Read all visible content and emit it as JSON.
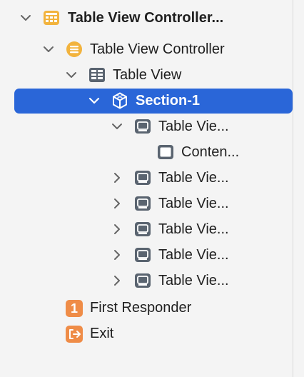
{
  "outline": {
    "items": [
      {
        "label": "Table View Controller...",
        "icon": "storyboard-scene-icon",
        "expanded": true
      },
      {
        "label": "Table View Controller",
        "icon": "table-view-controller-icon",
        "expanded": true
      },
      {
        "label": "Table View",
        "icon": "table-view-icon",
        "expanded": true
      },
      {
        "label": "Section-1",
        "icon": "section-icon",
        "expanded": true,
        "selected": true
      },
      {
        "label": "Table Vie...",
        "icon": "table-view-cell-icon",
        "expanded": true
      },
      {
        "label": "Conten...",
        "icon": "content-view-icon"
      },
      {
        "label": "Table Vie...",
        "icon": "table-view-cell-icon",
        "expanded": false
      },
      {
        "label": "Table Vie...",
        "icon": "table-view-cell-icon",
        "expanded": false
      },
      {
        "label": "Table Vie...",
        "icon": "table-view-cell-icon",
        "expanded": false
      },
      {
        "label": "Table Vie...",
        "icon": "table-view-cell-icon",
        "expanded": false
      },
      {
        "label": "Table Vie...",
        "icon": "table-view-cell-icon",
        "expanded": false
      },
      {
        "label": "First Responder",
        "icon": "first-responder-icon",
        "badge": "1"
      },
      {
        "label": "Exit",
        "icon": "exit-icon"
      }
    ]
  },
  "colors": {
    "selection": "#2a66d8",
    "scene_icon": "#f2b33d",
    "controller_icon": "#f2b33d",
    "cell_icon": "#5a6470",
    "orange_badge": "#ef8c47"
  }
}
